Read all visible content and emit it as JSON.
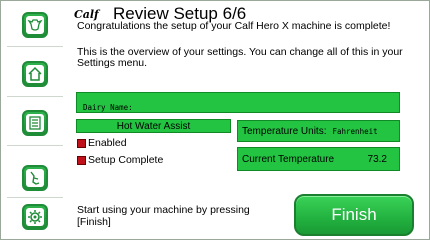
{
  "header": {
    "logo_text": "Calf",
    "title": "Review Setup 6/6"
  },
  "intro": {
    "line1": "Congratulations the setup of your Calf Hero X machine is complete!",
    "line2": "This is the overview of your settings. You can change all of this in your Settings menu."
  },
  "fields": {
    "dairy_name_label": "Dairy Name:",
    "dairy_name_value": "",
    "hot_water_assist_label": "Hot Water Assist",
    "enabled_label": "Enabled",
    "enabled_checked": false,
    "setup_complete_label": "Setup Complete",
    "setup_complete_checked": false,
    "temperature_units_label": "Temperature Units:",
    "temperature_units_value": "Fahrenheit",
    "current_temperature_label": "Current Temperature",
    "current_temperature_value": "73.2"
  },
  "footer": {
    "instruction": "Start using your machine by pressing [Finish]",
    "finish_label": "Finish"
  },
  "sidebar": {
    "items": [
      {
        "icon": "cow-head-icon"
      },
      {
        "icon": "home-icon"
      },
      {
        "icon": "document-icon"
      },
      {
        "icon": "calf-icon"
      },
      {
        "icon": "gear-icon"
      }
    ]
  },
  "colors": {
    "green_field": "#22c442",
    "button_green": "#22b13f",
    "checkbox_red": "#c0101a"
  }
}
